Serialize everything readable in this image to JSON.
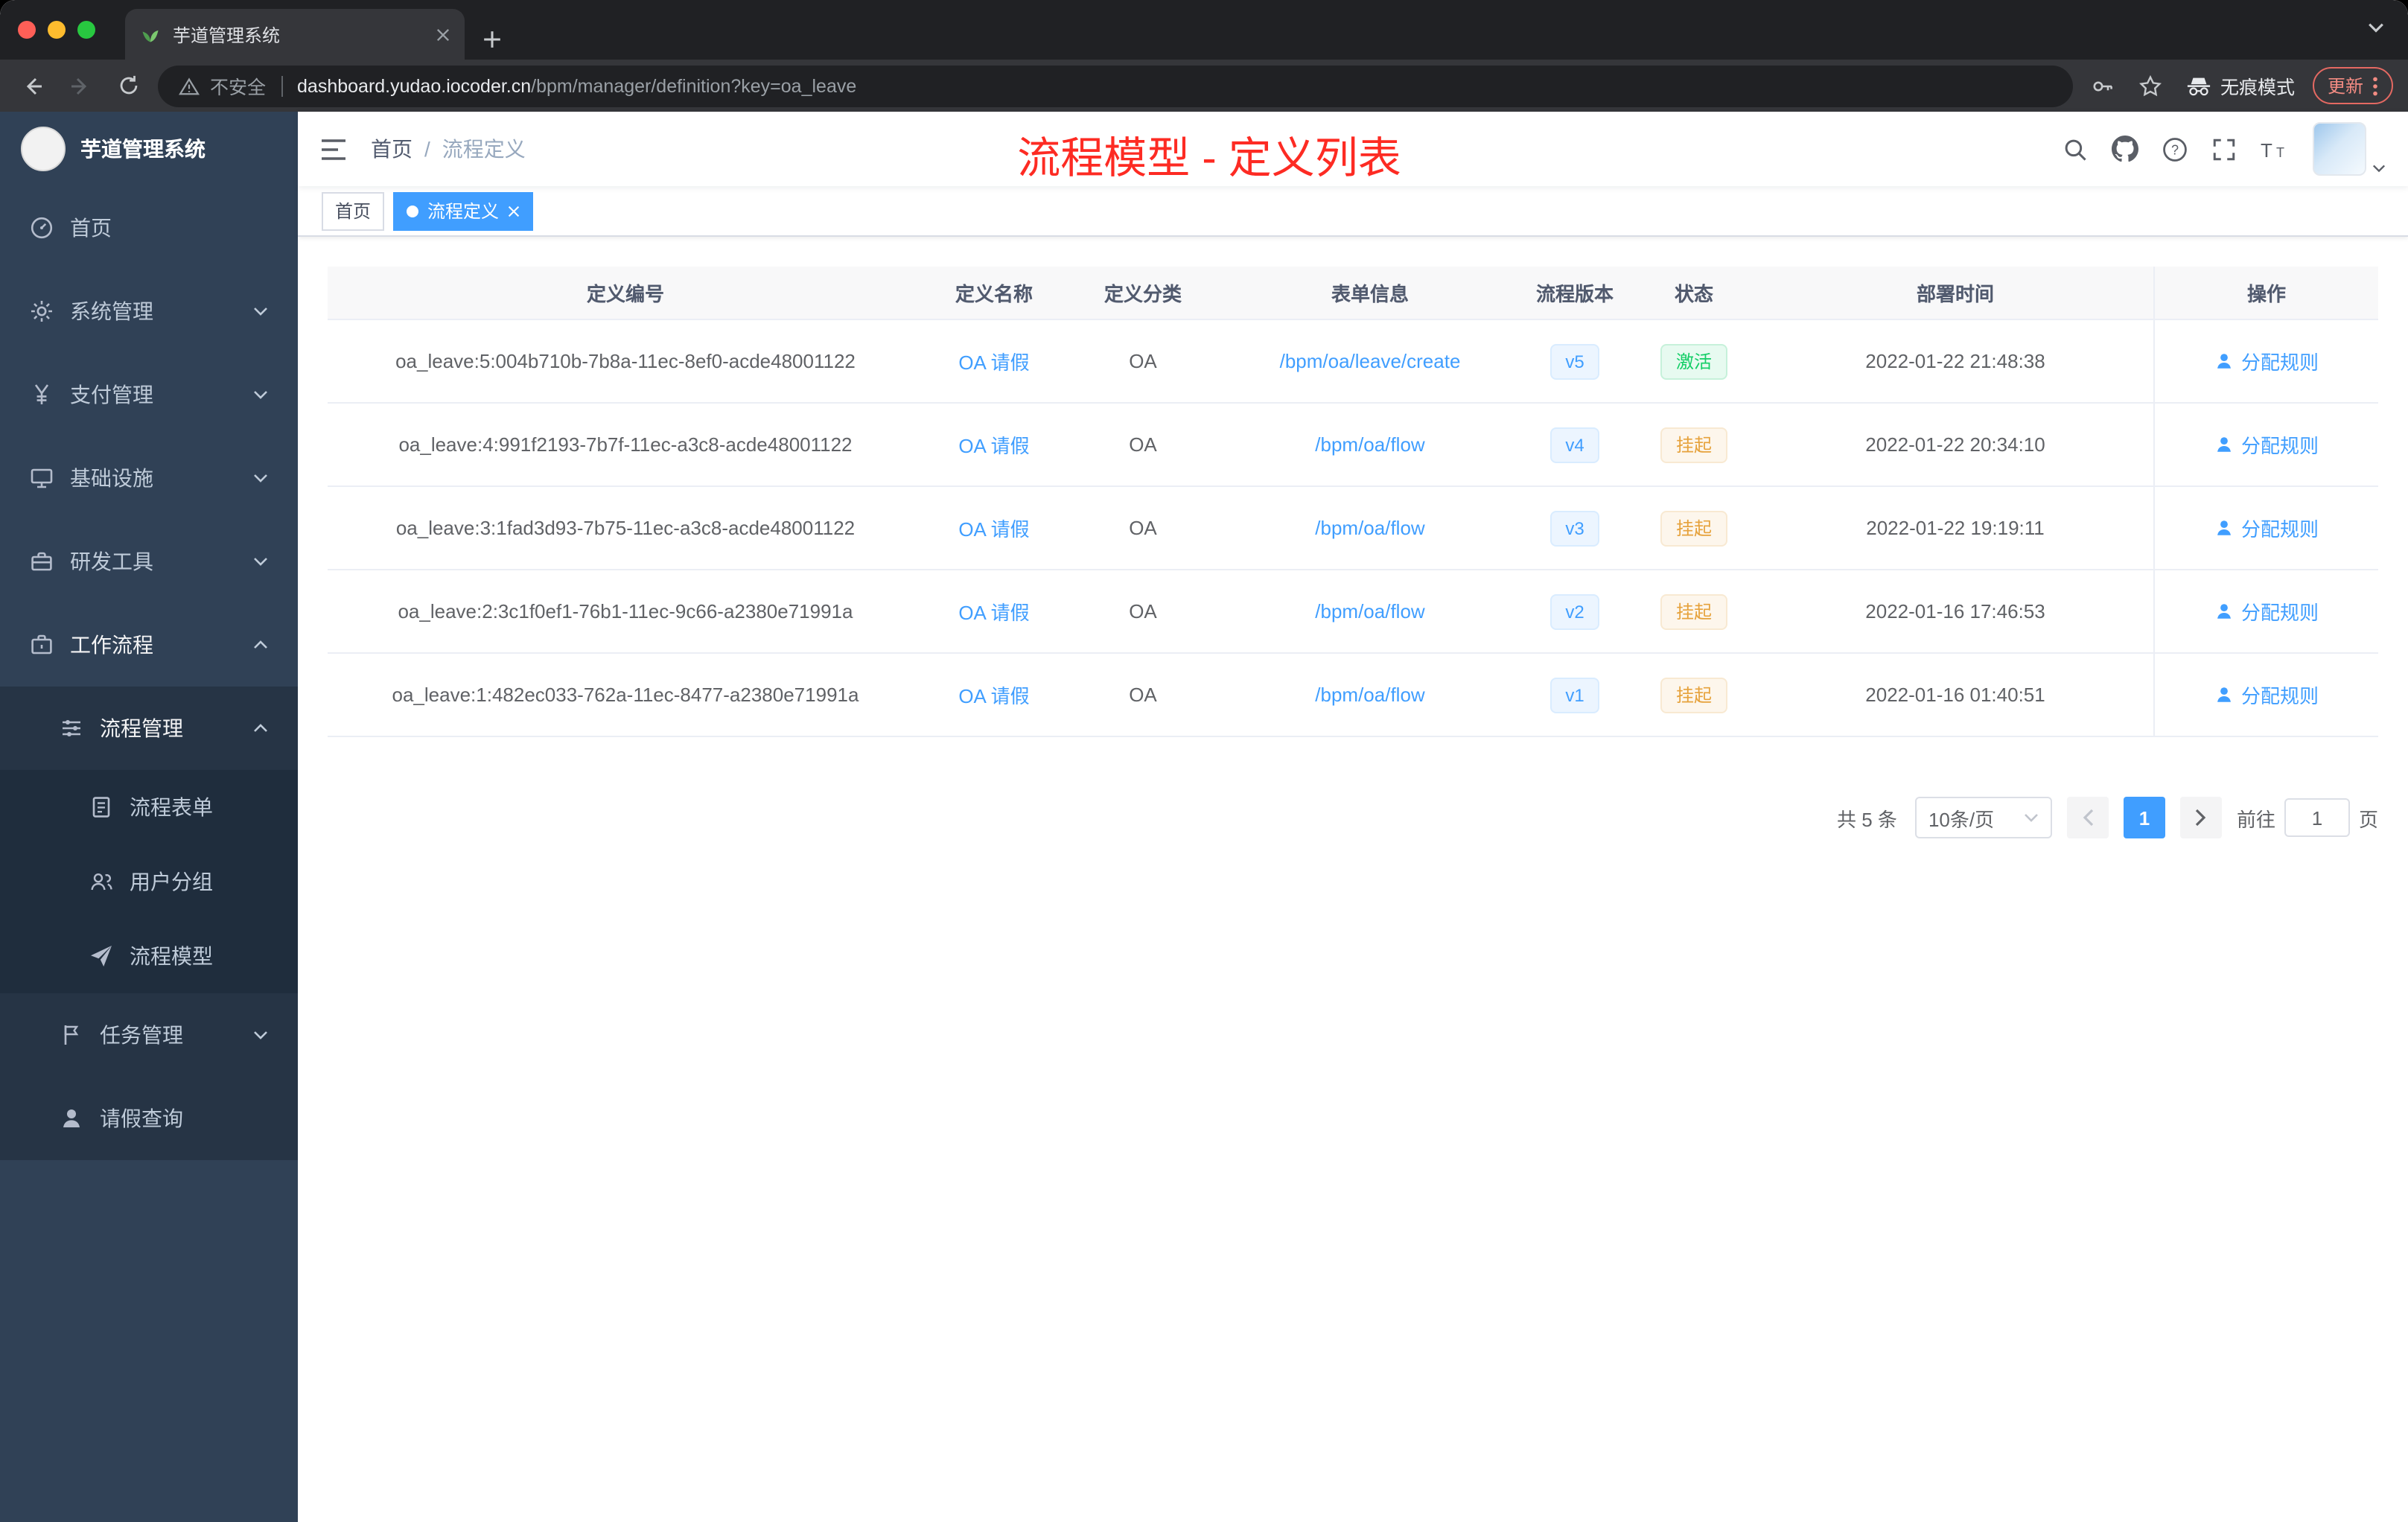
{
  "browser": {
    "tab_title": "芋道管理系统",
    "url": {
      "warning": "不安全",
      "host": "dashboard.yudao.iocoder.cn",
      "path": "/bpm/manager/definition?key=oa_leave"
    },
    "incognito_label": "无痕模式",
    "update_label": "更新"
  },
  "sidebar": {
    "logo_title": "芋道管理系统",
    "items": [
      {
        "label": "首页",
        "icon": "dashboard-icon"
      },
      {
        "label": "系统管理",
        "icon": "gear-icon"
      },
      {
        "label": "支付管理",
        "icon": "yen-icon"
      },
      {
        "label": "基础设施",
        "icon": "monitor-icon"
      },
      {
        "label": "研发工具",
        "icon": "toolbox-icon"
      },
      {
        "label": "工作流程",
        "icon": "briefcase-icon"
      },
      {
        "label": "流程管理",
        "icon": "operation-icon"
      },
      {
        "label": "流程表单",
        "icon": "form-icon"
      },
      {
        "label": "用户分组",
        "icon": "users-icon"
      },
      {
        "label": "流程模型",
        "icon": "send-icon"
      },
      {
        "label": "任务管理",
        "icon": "tasks-icon"
      },
      {
        "label": "请假查询",
        "icon": "user-icon"
      }
    ]
  },
  "header": {
    "breadcrumb_home": "首页",
    "breadcrumb_separator": "/",
    "breadcrumb_current": "流程定义",
    "annotation": "流程模型 - 定义列表"
  },
  "tags": {
    "home": "首页",
    "active": "流程定义"
  },
  "table": {
    "columns": [
      "定义编号",
      "定义名称",
      "定义分类",
      "表单信息",
      "流程版本",
      "状态",
      "部署时间",
      "操作"
    ],
    "rows": [
      {
        "id": "oa_leave:5:004b710b-7b8a-11ec-8ef0-acde48001122",
        "name": "OA 请假",
        "category": "OA",
        "form": "/bpm/oa/leave/create",
        "version": "v5",
        "status": "激活",
        "time": "2022-01-22 21:48:38",
        "action": "分配规则"
      },
      {
        "id": "oa_leave:4:991f2193-7b7f-11ec-a3c8-acde48001122",
        "name": "OA 请假",
        "category": "OA",
        "form": "/bpm/oa/flow",
        "version": "v4",
        "status": "挂起",
        "time": "2022-01-22 20:34:10",
        "action": "分配规则"
      },
      {
        "id": "oa_leave:3:1fad3d93-7b75-11ec-a3c8-acde48001122",
        "name": "OA 请假",
        "category": "OA",
        "form": "/bpm/oa/flow",
        "version": "v3",
        "status": "挂起",
        "time": "2022-01-22 19:19:11",
        "action": "分配规则"
      },
      {
        "id": "oa_leave:2:3c1f0ef1-76b1-11ec-9c66-a2380e71991a",
        "name": "OA 请假",
        "category": "OA",
        "form": "/bpm/oa/flow",
        "version": "v2",
        "status": "挂起",
        "time": "2022-01-16 17:46:53",
        "action": "分配规则"
      },
      {
        "id": "oa_leave:1:482ec033-762a-11ec-8477-a2380e71991a",
        "name": "OA 请假",
        "category": "OA",
        "form": "/bpm/oa/flow",
        "version": "v1",
        "status": "挂起",
        "time": "2022-01-16 01:40:51",
        "action": "分配规则"
      }
    ]
  },
  "pagination": {
    "total": "共 5 条",
    "page_size": "10条/页",
    "current_page": "1",
    "goto_label": "前往",
    "goto_value": "1",
    "page_unit": "页"
  },
  "colors": {
    "accent_blue": "#409eff",
    "sidebar_bg": "#304156",
    "status_active_green": "#13ce66",
    "status_suspended_orange": "#e6a23c",
    "annotation_red": "#fd2b23"
  }
}
